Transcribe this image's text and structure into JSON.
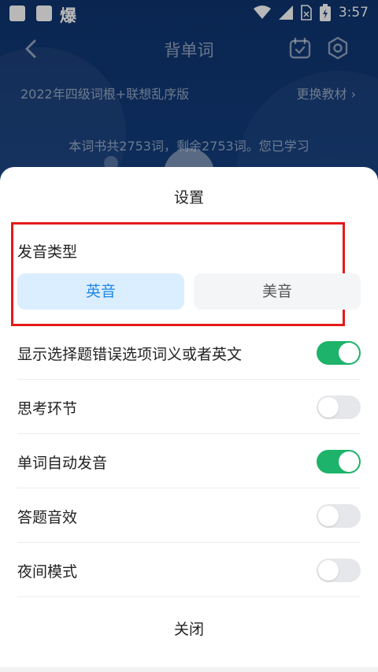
{
  "status_bar": {
    "notification_char": "爆",
    "time": "3:57"
  },
  "header": {
    "title": "背单词"
  },
  "book": {
    "name": "2022年四级词根+联想乱序版",
    "change_label": "更换教材 ›",
    "stats_text": "本词书共2753词，剩余2753词。您已学习"
  },
  "settings": {
    "title": "设置",
    "pronunciation": {
      "label": "发音类型",
      "options": [
        "英音",
        "美音"
      ],
      "selected": "英音"
    },
    "toggles": [
      {
        "label": "显示选择题错误选项词义或者英文",
        "on": true
      },
      {
        "label": "思考环节",
        "on": false
      },
      {
        "label": "单词自动发音",
        "on": true
      },
      {
        "label": "答题音效",
        "on": false
      },
      {
        "label": "夜间模式",
        "on": false
      }
    ],
    "close_label": "关闭"
  },
  "colors": {
    "accent_blue": "#1f87e8",
    "toggle_on": "#1db36a",
    "highlight_red": "#e31b1b"
  }
}
